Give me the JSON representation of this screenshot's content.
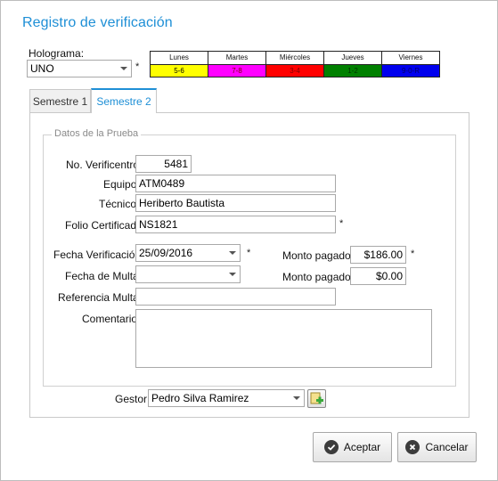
{
  "window": {
    "title": "Registro de verificación"
  },
  "holograma": {
    "label": "Holograma:",
    "value": "UNO",
    "required_mark": "*"
  },
  "schedule": {
    "days": [
      {
        "day": "Lunes",
        "range": "5-6",
        "color": "#ffff00",
        "text_color": "#000000"
      },
      {
        "day": "Martes",
        "range": "7-8",
        "color": "#ff00ff",
        "text_color": "#7a0000"
      },
      {
        "day": "Miércoles",
        "range": "3-4",
        "color": "#ff0000",
        "text_color": "#7a0000"
      },
      {
        "day": "Jueves",
        "range": "1-2",
        "color": "#008000",
        "text_color": "#003300"
      },
      {
        "day": "Viernes",
        "range": "9-0-R",
        "color": "#0000ee",
        "text_color": "#000066"
      }
    ]
  },
  "tabs": [
    {
      "label": "Semestre 1",
      "active": false
    },
    {
      "label": "Semestre 2",
      "active": true
    }
  ],
  "group": {
    "title": "Datos de la Prueba"
  },
  "form": {
    "no_verificentro": {
      "label": "No. Verificentro:",
      "value": "5481"
    },
    "equipo": {
      "label": "Equipo:",
      "value": "ATM0489"
    },
    "tecnico": {
      "label": "Técnico:",
      "value": "Heriberto Bautista"
    },
    "folio": {
      "label": "Folio Certificado:",
      "value": "NS1821",
      "required_mark": "*"
    },
    "fecha_verificacion": {
      "label": "Fecha Verificación:",
      "value": "25/09/2016",
      "required_mark": "*"
    },
    "monto_pagado_1": {
      "label": "Monto pagado:",
      "value": "$186.00",
      "required_mark": "*"
    },
    "fecha_multa": {
      "label": "Fecha de Multa:",
      "value": ""
    },
    "monto_pagado_2": {
      "label": "Monto pagado:",
      "value": "$0.00"
    },
    "referencia_multa": {
      "label": "Referencia Multa:",
      "value": ""
    },
    "comentario": {
      "label": "Comentario:",
      "value": ""
    }
  },
  "gestor": {
    "label": "Gestor:",
    "value": "Pedro Silva Ramirez",
    "add_icon": "add-icon"
  },
  "buttons": {
    "accept": "Aceptar",
    "cancel": "Cancelar"
  },
  "colors": {
    "accent": "#1e8fd6",
    "accept_icon": "check-icon",
    "cancel_icon": "close-icon"
  }
}
